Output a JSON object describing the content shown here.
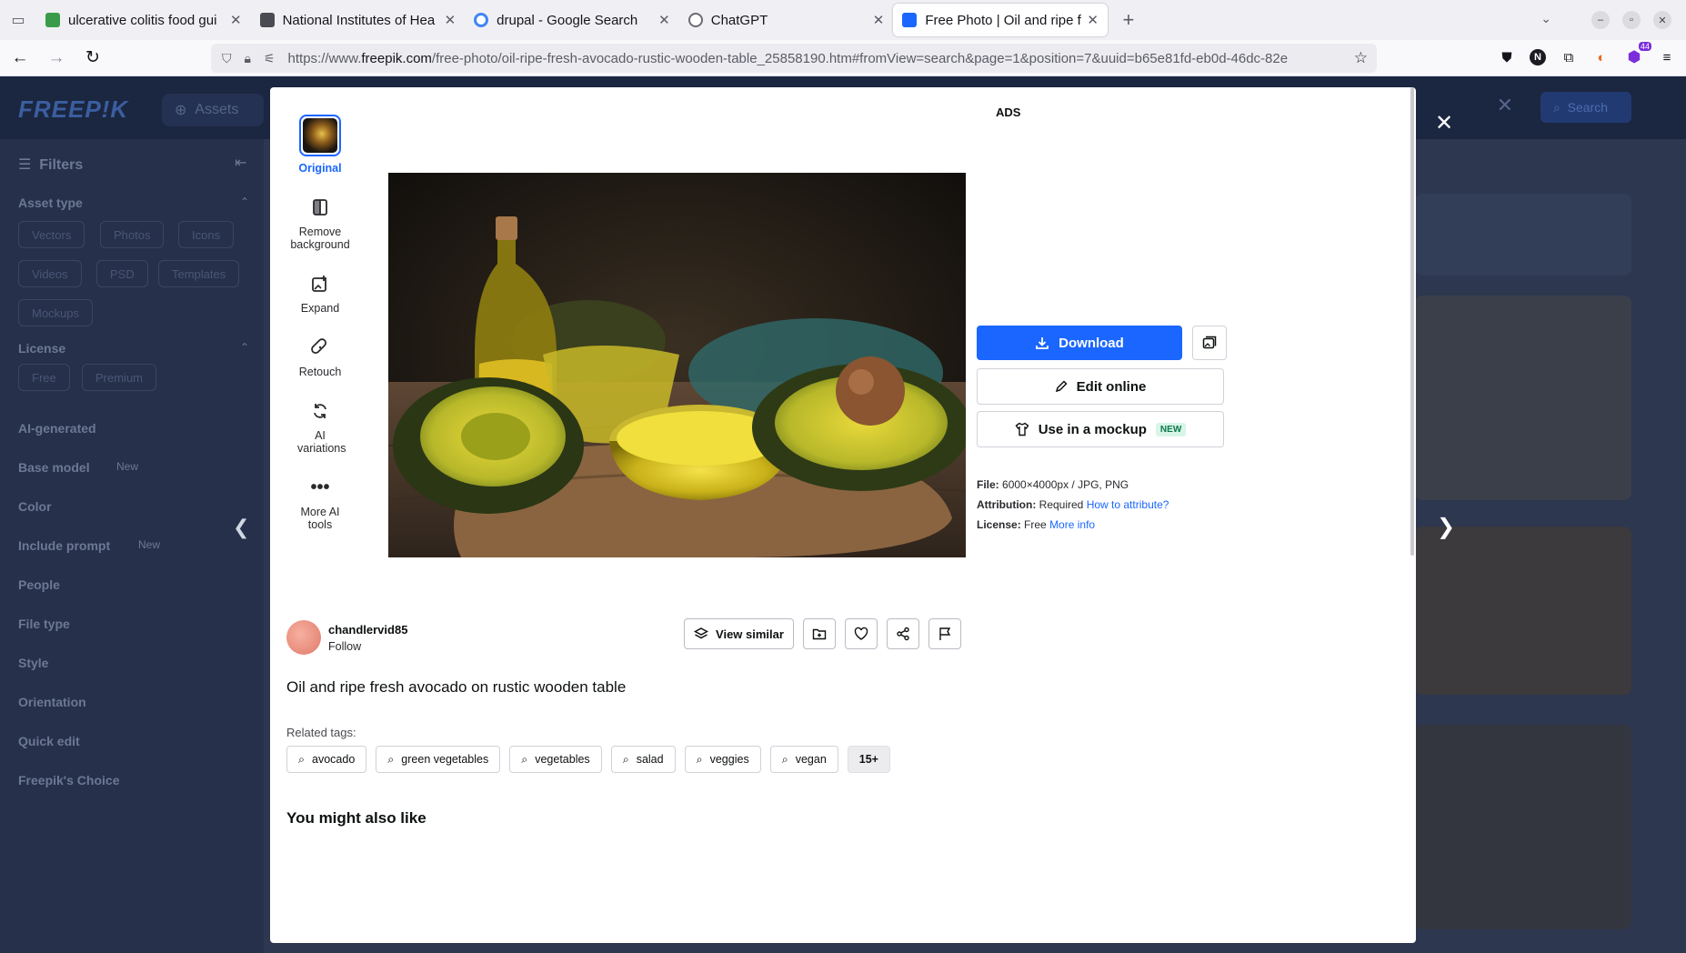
{
  "browser": {
    "tabs": [
      {
        "title": "ulcerative colitis food gui",
        "favicon_color": "#3a9c4a",
        "active": false
      },
      {
        "title": "National Institutes of Hea",
        "favicon_color": "#4a4a52",
        "active": false
      },
      {
        "title": "drupal - Google Search",
        "favicon_color": "#4285f4",
        "active": false
      },
      {
        "title": "ChatGPT",
        "favicon_color": "#6b6b72",
        "active": false
      },
      {
        "title": "Free Photo | Oil and ripe f",
        "favicon_color": "#1a66ff",
        "active": true
      }
    ],
    "url_prefix": "https://www.",
    "url_domain": "freepik.com",
    "url_rest": "/free-photo/oil-ripe-fresh-avocado-rustic-wooden-table_25858190.htm#fromView=search&page=1&position=7&uuid=b65e81fd-eb0d-46dc-82e",
    "extension_badge": "44"
  },
  "background_page": {
    "logo": "FREEP!K",
    "assets_label": "Assets",
    "search_label": "Search",
    "filters_title": "Filters",
    "filter_sections": [
      "Asset type",
      "License",
      "AI-generated",
      "Base model",
      "Color",
      "Include prompt",
      "People",
      "File type",
      "Style",
      "Orientation",
      "Quick edit",
      "Freepik's Choice"
    ],
    "asset_chips": [
      "Vectors",
      "Photos",
      "Icons",
      "Videos",
      "PSD",
      "Templates",
      "Mockups"
    ],
    "license_chips": [
      "Free",
      "Premium"
    ],
    "new_label": "New"
  },
  "tools": {
    "original": "Original",
    "remove_background": "Remove background",
    "expand": "Expand",
    "retouch": "Retouch",
    "ai_variations": "AI variations",
    "more_ai_tools": "More AI tools"
  },
  "ads_label": "ADS",
  "actions": {
    "download": "Download",
    "edit_online": "Edit online",
    "use_in_mockup": "Use in a mockup",
    "new_badge": "NEW",
    "view_similar": "View similar"
  },
  "meta": {
    "file_label": "File:",
    "file_value": "6000×4000px / JPG, PNG",
    "attribution_label": "Attribution:",
    "attribution_value": "Required",
    "attribution_link": "How to attribute?",
    "license_label": "License:",
    "license_value": "Free",
    "license_link": "More info"
  },
  "author": {
    "name": "chandlervid85",
    "follow": "Follow"
  },
  "image_title": "Oil and ripe fresh avocado on rustic wooden table",
  "related": {
    "label": "Related tags:",
    "tags": [
      "avocado",
      "green vegetables",
      "vegetables",
      "salad",
      "veggies",
      "vegan"
    ],
    "more": "15+"
  },
  "you_might_also_like": "You might also like"
}
